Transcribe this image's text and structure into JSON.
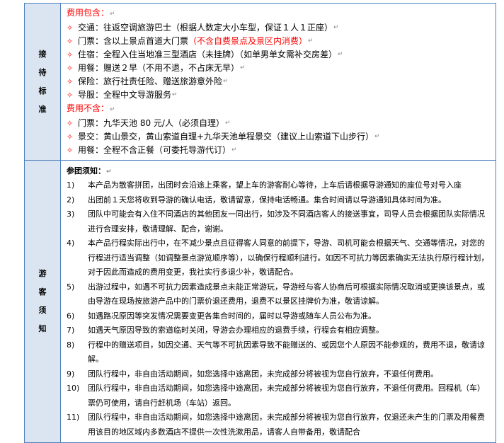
{
  "section1": {
    "label": "接待标准",
    "include_title": "费用包含：",
    "include_items": [
      {
        "text": "交通：往返空调旅游巴士（根据人数定大小车型，保证１人１正座）",
        "red": ""
      },
      {
        "text": "门票：含以上景点首道大门票",
        "red": "（不含自费景点及景区内消费）"
      },
      {
        "text": "住宿：全程入住当地准三型酒店（未挂牌）（如单男单女需补交房差）",
        "red": ""
      },
      {
        "text": "用餐：赠送２早（不用不退，不占床无早）",
        "red": ""
      },
      {
        "text": "保险：旅行社责任险、赠送旅游意外险",
        "red": ""
      },
      {
        "text": "导服：全程中文导游服务",
        "red": ""
      }
    ],
    "exclude_title": "费用不含：",
    "exclude_items": [
      {
        "text": "门票：九华天池 80 元/人（必须自理）",
        "red": ""
      },
      {
        "text": "景交：黄山景交，黄山索道自理+九华天池单程景交（建议上山索道下山步行）",
        "red": ""
      },
      {
        "text": "用餐：全程不含正餐（可委托导游代订）",
        "red": ""
      }
    ]
  },
  "section2": {
    "label": "游客须知",
    "title": "参团须知：",
    "notes": [
      {
        "num": "1)",
        "text": "本产品为散客拼团，出团时会沿途上乘客，望上车的游客耐心等待，上车后请根据导游通知的座位号对号入座"
      },
      {
        "num": "2)",
        "text": "出团前１天您将收到导游的确认电话，敬请留意，保持电话畅通。集合时间请以导游通知具体时间为准。"
      },
      {
        "num": "3)",
        "text": "团队中可能会有入住不同酒店的其他团友一同出行，如涉及不同酒店客人的接送事宜，司导人员会根据团队实际情况进行合理安排，敬请理解、配合，谢谢。"
      },
      {
        "num": "4)",
        "text": "本产品行程实际出行中，在不减少景点且征得客人同意的前提下，导游、司机可能会根据天气、交通等情况，对您的行程进行适当调整（如调整景点游览顺序等），以确保行程顺利进行。如因不可抗力等因素确实无法执行原行程计划，对于因此而造成的费用变更，我社实行多退少补，敬请配合。"
      },
      {
        "num": "5)",
        "text": "出游过程中，如遇不可抗力因素造成景点未能正常游玩，导游经与客人协商后可根据实际情况取消或更换该景点，或由导游在现场按旅游产品中的门票价退还费用，退费不以景区挂牌价为准，敬请谅解。"
      },
      {
        "num": "6)",
        "text": "如遇路况原因等突发情况需要变更各集合时间的，届时以导游或随车人员公布为准。"
      },
      {
        "num": "7)",
        "text": "如遇天气原因导致的索道临时关闭，导游会办理相应的退费手续，行程会有相应调整。"
      },
      {
        "num": "8)",
        "text": "行程中的赠送项目，如因交通、天气等不可抗因素导致不能赠送的、或因您个人原因不能参观的，费用不退，敬请谅解。"
      },
      {
        "num": "9)",
        "text": "团队行程中，非自由活动期间，如您选择中途离团，未完成部分将被视为您自行放弃，不退任何费用。"
      },
      {
        "num": "10)",
        "text": "团队行程中，非自由活动期间，如您选择中途离团，未完成部分将被视为您自行放弃，不退任何费用。回程机（车）票仍可使用，请自行赶机场（车站）返回。"
      },
      {
        "num": "11)",
        "text": "团队行程中，非自由活动期间，如您选择中途离团，未完成部分将被视为您自行放弃，仅退还未产生的门票及用餐费用该目的地区域内多数酒店不提供一次性洗漱用品，请客人自带备用，敬请配合"
      }
    ]
  }
}
